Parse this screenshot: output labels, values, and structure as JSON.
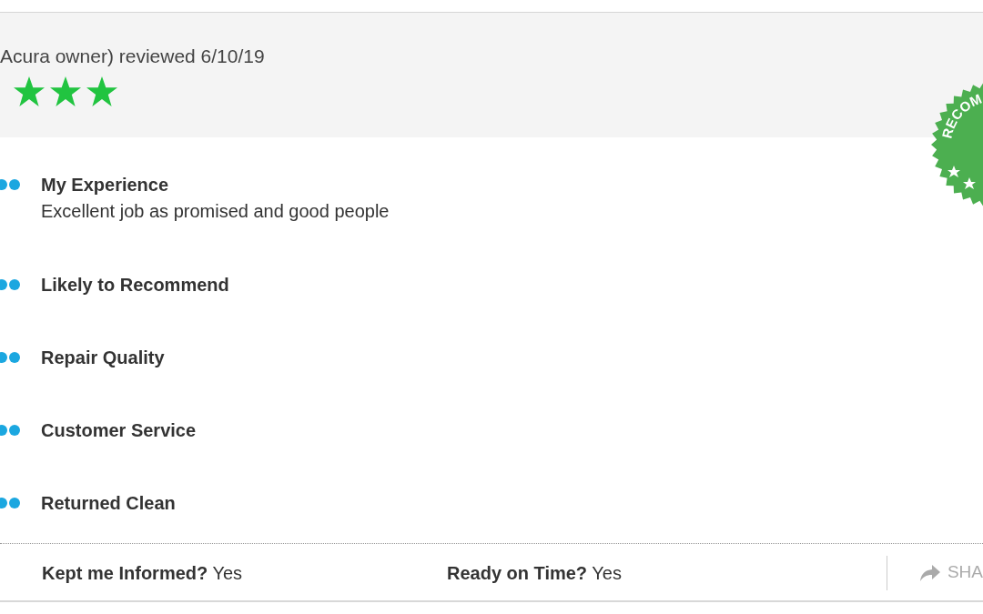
{
  "review": {
    "byline": "Acura owner) reviewed 6/10/19",
    "stars": 3
  },
  "badge": {
    "text": "RECOM"
  },
  "sections": [
    {
      "title": "My Experience",
      "text": "Excellent job as promised and good people"
    },
    {
      "title": "Likely to Recommend"
    },
    {
      "title": "Repair Quality"
    },
    {
      "title": "Customer Service"
    },
    {
      "title": "Returned Clean"
    }
  ],
  "footer": {
    "questions": [
      {
        "label": "Kept me Informed?",
        "answer": "Yes"
      },
      {
        "label": "Ready on Time?",
        "answer": "Yes"
      }
    ],
    "share": "SHA"
  }
}
